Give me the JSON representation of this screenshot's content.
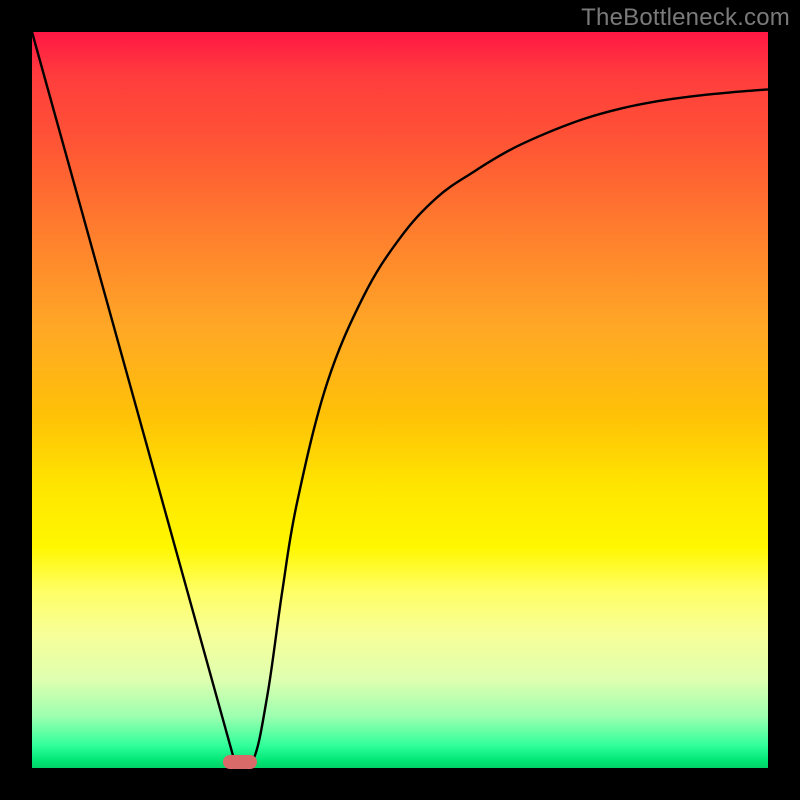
{
  "watermark": "TheBottleneck.com",
  "chart_data": {
    "type": "line",
    "title": "",
    "xlabel": "",
    "ylabel": "",
    "x_range": [
      0,
      100
    ],
    "y_range": [
      0,
      100
    ],
    "background_gradient": {
      "direction": "top-to-bottom",
      "stops": [
        {
          "pos": 0.0,
          "color": "#ff1744"
        },
        {
          "pos": 0.4,
          "color": "#ffa726"
        },
        {
          "pos": 0.7,
          "color": "#ffff00"
        },
        {
          "pos": 1.0,
          "color": "#00e676"
        }
      ],
      "meaning": "red=high bottleneck, green=low bottleneck"
    },
    "series": [
      {
        "name": "bottleneck-curve",
        "x": [
          0,
          5,
          10,
          15,
          20,
          25,
          27.5,
          30,
          32,
          34,
          36,
          40,
          45,
          50,
          55,
          60,
          65,
          70,
          75,
          80,
          85,
          90,
          95,
          100
        ],
        "y": [
          100,
          82,
          64,
          46,
          28,
          10,
          1,
          1,
          10,
          24,
          36,
          52,
          64,
          72,
          77.5,
          81,
          84,
          86.3,
          88.2,
          89.6,
          90.6,
          91.3,
          91.8,
          92.2
        ]
      }
    ],
    "marker": {
      "name": "optimal-point",
      "x": 28.3,
      "y": 0.8,
      "color": "#d86a6a"
    },
    "min_point": {
      "x": 27.5,
      "y": 0
    }
  },
  "colors": {
    "frame": "#000000",
    "curve": "#000000",
    "watermark": "#7a7a7a",
    "marker": "#d86a6a"
  }
}
